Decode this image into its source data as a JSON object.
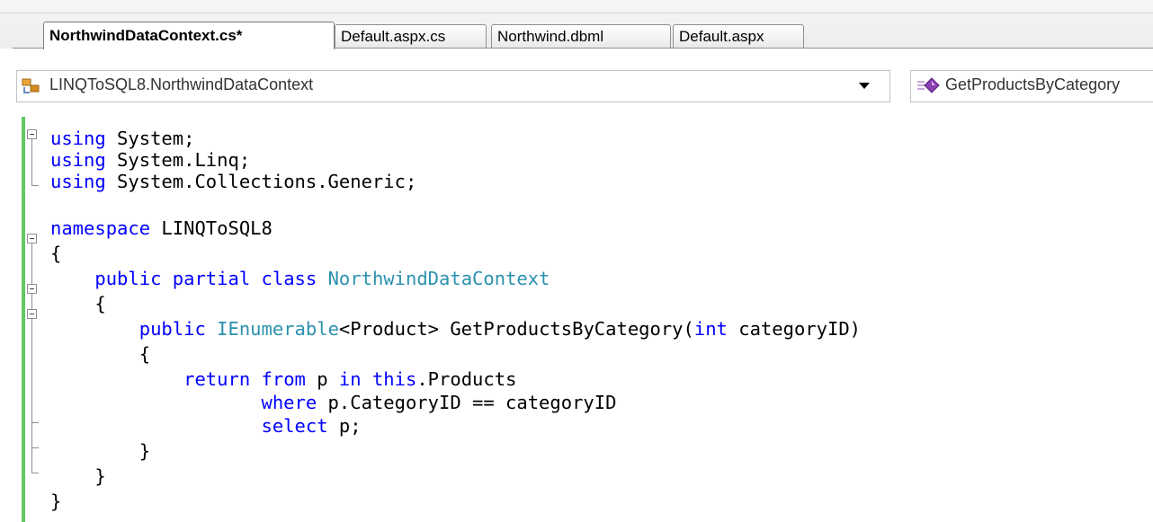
{
  "tabs": [
    {
      "label": "NorthwindDataContext.cs*",
      "active": true
    },
    {
      "label": "Default.aspx.cs",
      "active": false
    },
    {
      "label": "Northwind.dbml",
      "active": false
    },
    {
      "label": "Default.aspx",
      "active": false
    }
  ],
  "navigation": {
    "type_dropdown": {
      "value": "LINQToSQL8.NorthwindDataContext",
      "icon": "class-icon"
    },
    "member_dropdown": {
      "value": "GetProductsByCategory",
      "icon": "method-icon"
    }
  },
  "code": {
    "lines": [
      {
        "indent": "",
        "tokens": [
          {
            "t": "using",
            "c": "kw"
          },
          {
            "t": " System;",
            "c": ""
          }
        ]
      },
      {
        "indent": "",
        "tokens": [
          {
            "t": "using",
            "c": "kw"
          },
          {
            "t": " System.Linq;",
            "c": ""
          }
        ]
      },
      {
        "indent": "",
        "tokens": [
          {
            "t": "using",
            "c": "kw"
          },
          {
            "t": " System.Collections.Generic;",
            "c": ""
          }
        ]
      },
      {
        "indent": "",
        "tokens": []
      },
      {
        "indent": "",
        "tokens": [
          {
            "t": "namespace",
            "c": "kw"
          },
          {
            "t": " LINQToSQL8",
            "c": ""
          }
        ]
      },
      {
        "indent": "",
        "tokens": [
          {
            "t": "{",
            "c": ""
          }
        ]
      },
      {
        "indent": "    ",
        "tokens": [
          {
            "t": "public",
            "c": "kw"
          },
          {
            "t": " ",
            "c": ""
          },
          {
            "t": "partial",
            "c": "kw"
          },
          {
            "t": " ",
            "c": ""
          },
          {
            "t": "class",
            "c": "kw"
          },
          {
            "t": " ",
            "c": ""
          },
          {
            "t": "NorthwindDataContext",
            "c": "ty"
          }
        ]
      },
      {
        "indent": "    ",
        "tokens": [
          {
            "t": "{",
            "c": ""
          }
        ]
      },
      {
        "indent": "        ",
        "tokens": [
          {
            "t": "public",
            "c": "kw"
          },
          {
            "t": " ",
            "c": ""
          },
          {
            "t": "IEnumerable",
            "c": "ty"
          },
          {
            "t": "<Product> GetProductsByCategory(",
            "c": ""
          },
          {
            "t": "int",
            "c": "kw"
          },
          {
            "t": " categoryID)",
            "c": ""
          }
        ]
      },
      {
        "indent": "        ",
        "tokens": [
          {
            "t": "{",
            "c": ""
          }
        ]
      },
      {
        "indent": "            ",
        "tokens": [
          {
            "t": "return",
            "c": "kw"
          },
          {
            "t": " ",
            "c": ""
          },
          {
            "t": "from",
            "c": "kw"
          },
          {
            "t": " p ",
            "c": ""
          },
          {
            "t": "in",
            "c": "kw"
          },
          {
            "t": " ",
            "c": ""
          },
          {
            "t": "this",
            "c": "kw"
          },
          {
            "t": ".Products",
            "c": ""
          }
        ]
      },
      {
        "indent": "                   ",
        "tokens": [
          {
            "t": "where",
            "c": "kw"
          },
          {
            "t": " p.CategoryID == categoryID",
            "c": ""
          }
        ]
      },
      {
        "indent": "                   ",
        "tokens": [
          {
            "t": "select",
            "c": "kw"
          },
          {
            "t": " p;",
            "c": ""
          }
        ]
      },
      {
        "indent": "        ",
        "tokens": [
          {
            "t": "}",
            "c": ""
          }
        ]
      },
      {
        "indent": "    ",
        "tokens": [
          {
            "t": "}",
            "c": ""
          }
        ]
      },
      {
        "indent": "",
        "tokens": [
          {
            "t": "}",
            "c": ""
          }
        ]
      }
    ]
  }
}
